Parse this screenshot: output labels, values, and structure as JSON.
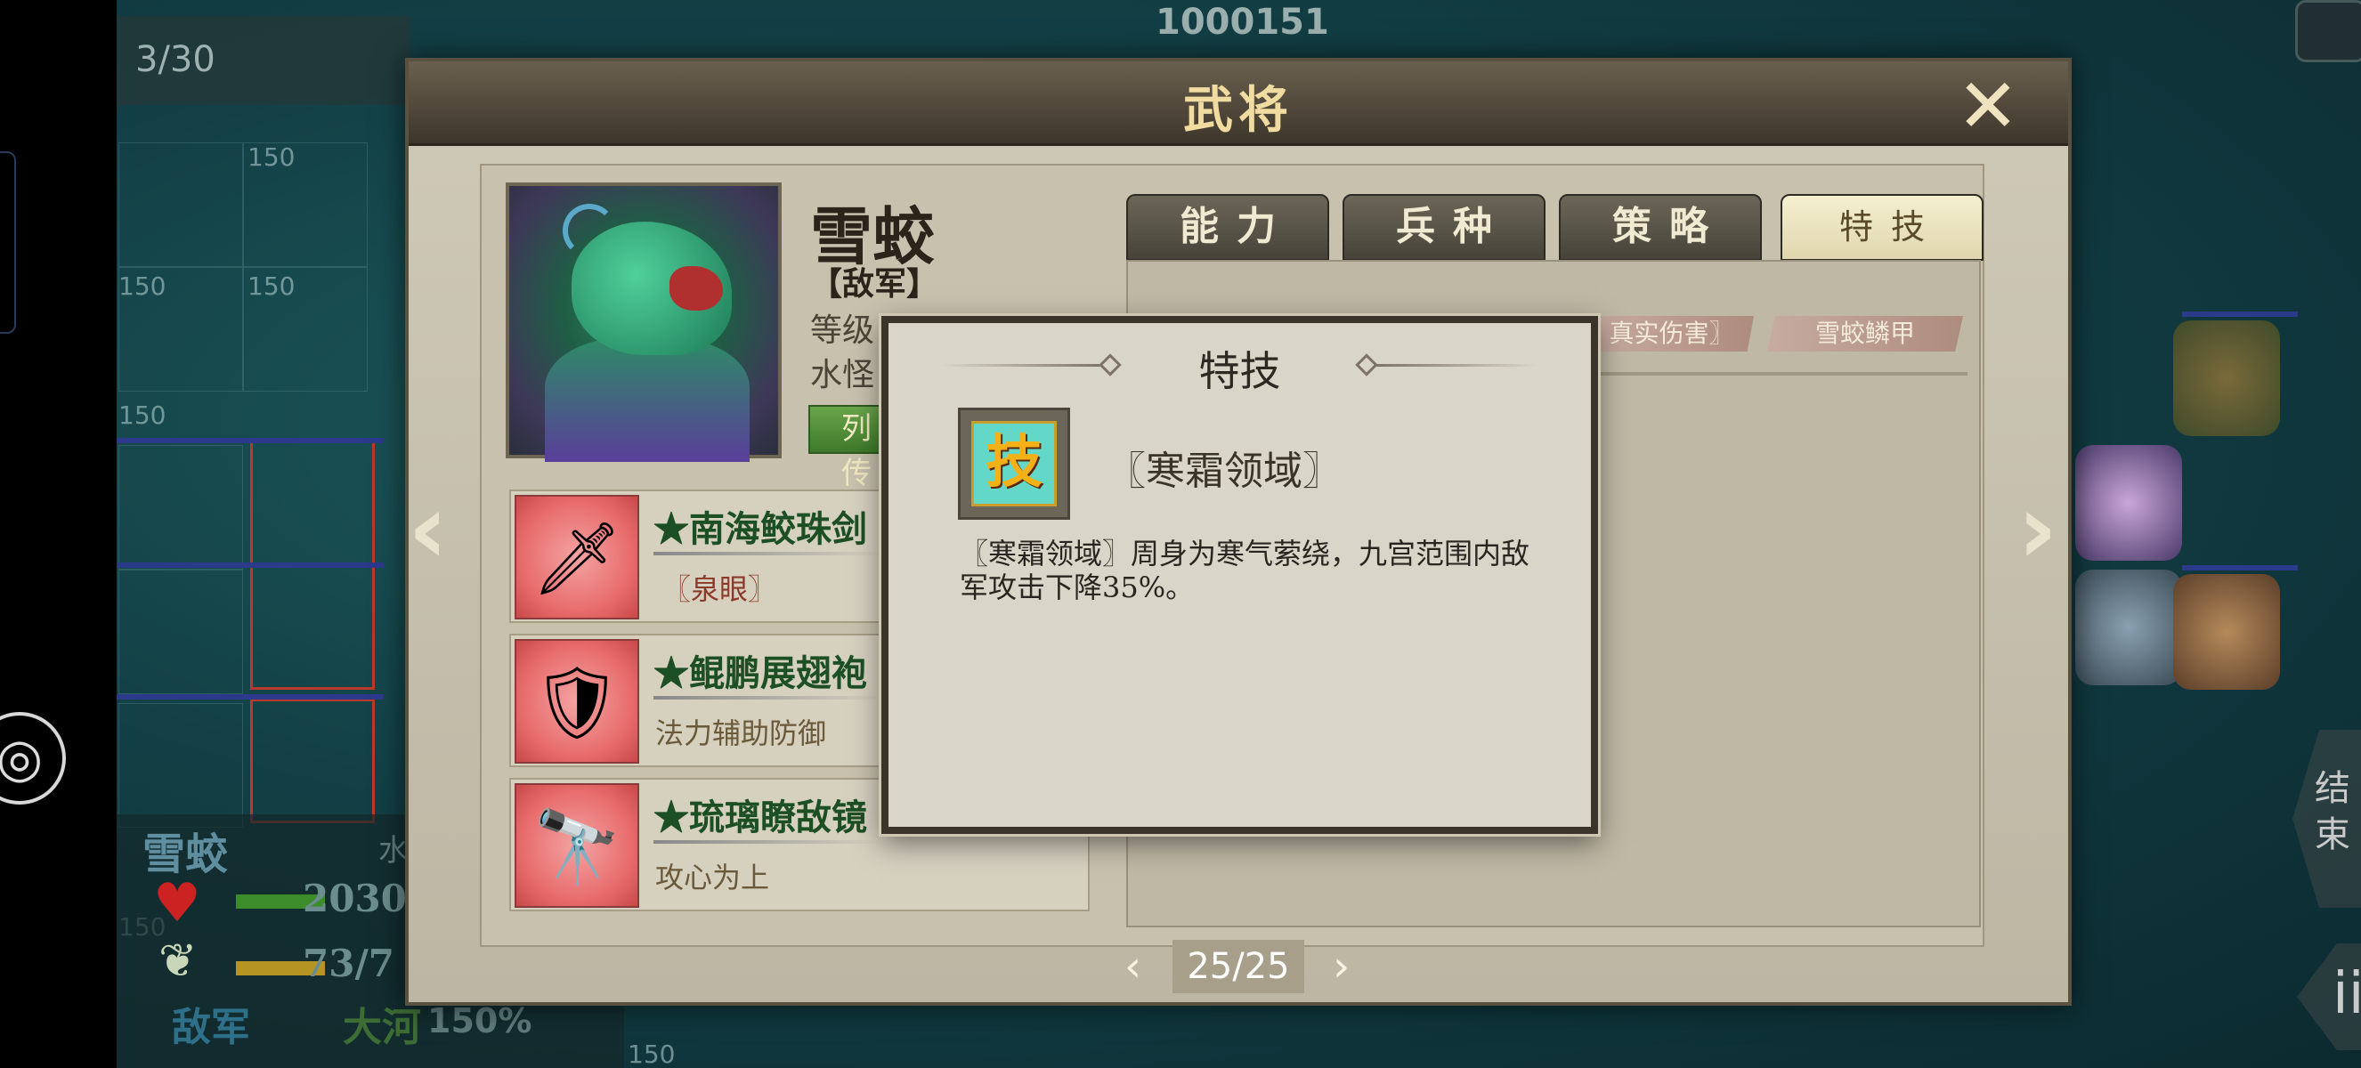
{
  "hud": {
    "top_id": "1000151",
    "turn": "3/30",
    "tile_value": "150",
    "end_turn_label": "结束",
    "menu_glyph": "ii"
  },
  "unit_panel": {
    "name": "雪蛟",
    "type": "水",
    "hp": "2030",
    "mp": "73/7",
    "side": "敌军",
    "terrain": "大河",
    "terrain_bonus": "150%"
  },
  "dialog": {
    "title": "武将",
    "close_icon": "close-x",
    "character": {
      "name": "雪蛟",
      "side": "【敌军】",
      "level_label": "等级",
      "race_label": "水怪",
      "bio_button": "列传"
    },
    "items": [
      {
        "name": "★南海鲛珠剑",
        "sub": "〖泉眼〗",
        "icon": "sword"
      },
      {
        "name": "★鲲鹏展翅袍",
        "sub": "法力辅助防御",
        "icon": "robe"
      },
      {
        "name": "★琉璃瞭敌镜",
        "sub": "攻心为上",
        "icon": "spyglass"
      }
    ],
    "tabs": [
      {
        "label": "能力",
        "active": false
      },
      {
        "label": "兵种",
        "active": false
      },
      {
        "label": "策略",
        "active": false
      },
      {
        "label": "特技",
        "active": true
      }
    ],
    "skill_tags": [
      "真实伤害〗",
      "雪蛟鳞甲"
    ],
    "pager": {
      "current": "25/25",
      "prev": "‹",
      "next": "›"
    },
    "nav_prev": "‹",
    "nav_next": "›"
  },
  "popup": {
    "title": "特技",
    "skill_icon_glyph": "技",
    "skill_name": "〖寒霜领域〗",
    "skill_desc": "〖寒霜领域〗周身为寒气萦绕，九宫范围内敌军攻击下降35%。"
  },
  "colors": {
    "title_gold": "#f0dba0",
    "item_name_green": "#1d4f25",
    "item_sub_red": "#8b3a2a",
    "skill_icon_bg": "#63d8c9",
    "tab_active": "#f4efd0"
  }
}
